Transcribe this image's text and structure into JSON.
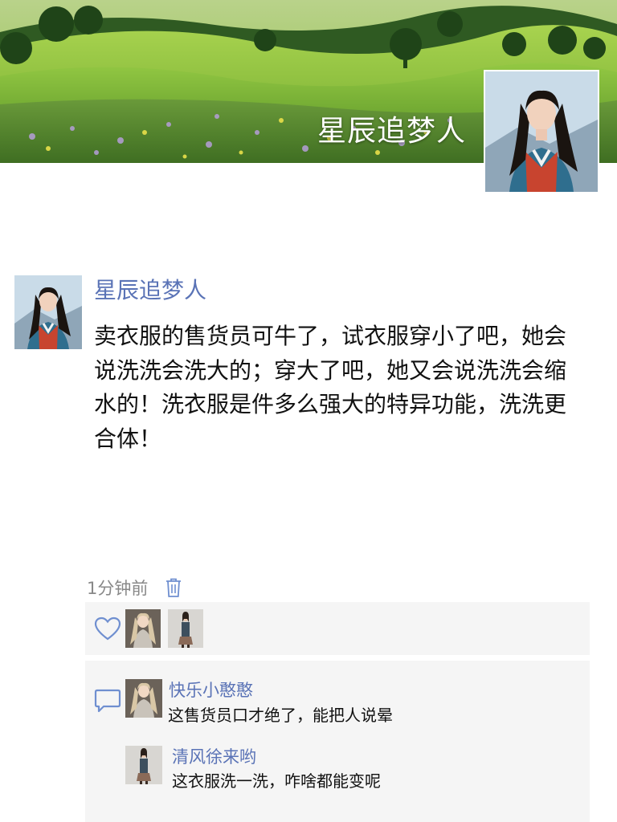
{
  "profile": {
    "cover_name": "星辰追梦人",
    "cover_image": "green-hills-landscape",
    "avatar_image": "woman-in-hanbok"
  },
  "post": {
    "author": "星辰追梦人",
    "avatar_image": "woman-in-hanbok",
    "text": "卖衣服的售货员可牛了，试衣服穿小了吧，她会说洗洗会洗大的；穿大了吧，她又会说洗洗会缩水的！洗衣服是件多么强大的特异功能，洗洗更合体！",
    "time": "1分钟前",
    "delete_icon": "trash-icon"
  },
  "likes": {
    "icon": "heart-icon",
    "users": [
      {
        "avatar_image": "woman-silver-dress"
      },
      {
        "avatar_image": "woman-standing"
      }
    ]
  },
  "comments": {
    "icon": "comment-icon",
    "items": [
      {
        "name": "快乐小憨憨",
        "text": "这售货员口才绝了，能把人说晕",
        "avatar_image": "woman-silver-dress"
      },
      {
        "name": "清风徐来哟",
        "text": "这衣服洗一洗，咋啥都能变呢",
        "avatar_image": "woman-standing"
      }
    ]
  },
  "colors": {
    "link_blue": "#5a73b6",
    "panel_gray": "#f5f5f5",
    "time_gray": "#888888",
    "icon_blue": "#6f8fd0"
  }
}
